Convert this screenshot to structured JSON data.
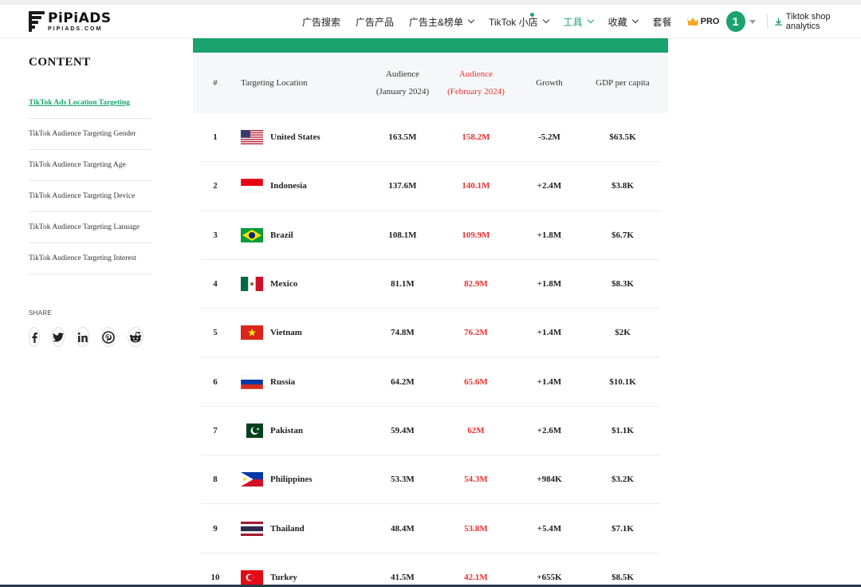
{
  "brand": {
    "name": "PiPiADS",
    "sub": "PIPIADS.COM"
  },
  "nav": {
    "items": [
      {
        "label": "广告搜索",
        "chevron": false,
        "dot": false,
        "active": false
      },
      {
        "label": "广告产品",
        "chevron": false,
        "dot": false,
        "active": false
      },
      {
        "label": "广告主&榜单",
        "chevron": true,
        "dot": false,
        "active": false
      },
      {
        "label": "TikTok 小店",
        "chevron": true,
        "dot": true,
        "active": false
      },
      {
        "label": "工具",
        "chevron": true,
        "dot": false,
        "active": true
      },
      {
        "label": "收藏",
        "chevron": true,
        "dot": false,
        "active": false
      },
      {
        "label": "套餐",
        "chevron": false,
        "dot": false,
        "active": false
      }
    ],
    "pro_label": "PRO",
    "avatar_text": "1",
    "shop_analytics": "Tiktok shop analytics"
  },
  "sidebar": {
    "title": "CONTENT",
    "items": [
      {
        "label": "TikTok Ads Location Targeting",
        "active": true
      },
      {
        "label": "TikTok Audience Targeting Gender",
        "active": false
      },
      {
        "label": "TikTok Audience Targeting Age",
        "active": false
      },
      {
        "label": "TikTok Audience Targeting Device",
        "active": false
      },
      {
        "label": "TikTok Audience Targeting Lanuage",
        "active": false
      },
      {
        "label": "TikTok Audience Targeting Interest",
        "active": false
      }
    ],
    "share_label": "SHARE",
    "share_icons": [
      "facebook-icon",
      "twitter-icon",
      "linkedin-icon",
      "pinterest-icon",
      "reddit-icon"
    ]
  },
  "table": {
    "headers": {
      "num": "#",
      "location": "Targeting Location",
      "aud1_line1": "Audience",
      "aud1_line2": "(January 2024)",
      "aud2_line1": "Audience",
      "aud2_line2": "(February 2024)",
      "growth": "Growth",
      "gdp": "GDP per capita"
    },
    "rows": [
      {
        "num": "1",
        "country": "United States",
        "flag": "us",
        "aud_jan": "163.5M",
        "aud_feb": "158.2M",
        "growth": "-5.2M",
        "gdp": "$63.5K"
      },
      {
        "num": "2",
        "country": "Indonesia",
        "flag": "id",
        "aud_jan": "137.6M",
        "aud_feb": "140.1M",
        "growth": "+2.4M",
        "gdp": "$3.8K"
      },
      {
        "num": "3",
        "country": "Brazil",
        "flag": "br",
        "aud_jan": "108.1M",
        "aud_feb": "109.9M",
        "growth": "+1.8M",
        "gdp": "$6.7K"
      },
      {
        "num": "4",
        "country": "Mexico",
        "flag": "mx",
        "aud_jan": "81.1M",
        "aud_feb": "82.9M",
        "growth": "+1.8M",
        "gdp": "$8.3K"
      },
      {
        "num": "5",
        "country": "Vietnam",
        "flag": "vn",
        "aud_jan": "74.8M",
        "aud_feb": "76.2M",
        "growth": "+1.4M",
        "gdp": "$2K"
      },
      {
        "num": "6",
        "country": "Russia",
        "flag": "ru",
        "aud_jan": "64.2M",
        "aud_feb": "65.6M",
        "growth": "+1.4M",
        "gdp": "$10.1K"
      },
      {
        "num": "7",
        "country": "Pakistan",
        "flag": "pk",
        "aud_jan": "59.4M",
        "aud_feb": "62M",
        "growth": "+2.6M",
        "gdp": "$1.1K"
      },
      {
        "num": "8",
        "country": "Philippines",
        "flag": "ph",
        "aud_jan": "53.3M",
        "aud_feb": "54.3M",
        "growth": "+984K",
        "gdp": "$3.2K"
      },
      {
        "num": "9",
        "country": "Thailand",
        "flag": "th",
        "aud_jan": "48.4M",
        "aud_feb": "53.8M",
        "growth": "+5.4M",
        "gdp": "$7.1K"
      },
      {
        "num": "10",
        "country": "Turkey",
        "flag": "tr",
        "aud_jan": "41.5M",
        "aud_feb": "42.1M",
        "growth": "+655K",
        "gdp": "$8.5K"
      }
    ]
  },
  "colors": {
    "accent": "#1aa36f",
    "red": "#e8322e",
    "header_bg": "#f6f7f9"
  }
}
